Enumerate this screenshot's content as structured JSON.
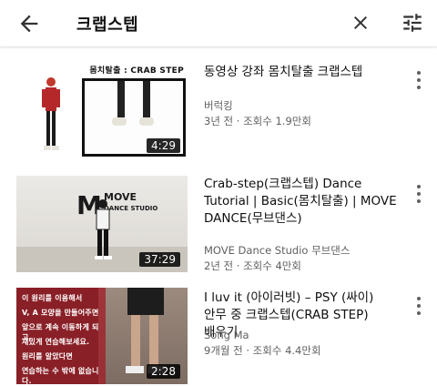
{
  "search": {
    "query": "크랩스텝"
  },
  "icons": {
    "back": "arrow-left-icon",
    "clear": "close-icon",
    "filter": "tune-filter-icon",
    "more": "more-vertical-icon"
  },
  "results": [
    {
      "title": "동영상 강좌 몸치탈출   크랩스텝",
      "channel": "버럭킹",
      "meta": "3년 전 · 조회수 1.9만회",
      "duration": "4:29",
      "thumb_caption": "몸치탈출 : CRAB STEP"
    },
    {
      "title": "Crab-step(크랩스텝) Dance Tutorial | Basic(몸치탈출) | MOVE DANCE(무브댄스)",
      "channel": "MOVE Dance Studio 무브댄스",
      "meta": "2년 전 · 조회수 4만회",
      "duration": "37:29",
      "thumb_logo": "MOVE",
      "thumb_logo_sub": "DANCE STUDIO"
    },
    {
      "title": "I luv it (아이러빗) – PSY (싸이) 안무 중 크랩스텝(CRAB STEP) 배우기",
      "channel": "Song Ma",
      "meta": "9개월 전 · 조회수 4.4만회",
      "duration": "2:28",
      "thumb_lines": [
        "이 원리를 이용해서",
        "V, A 모양을 만들어주면",
        "앞으로 계속 이동하게 되고,",
        "재밌게 연습해보세요.",
        "원리를 알았다면",
        "연습하는 수 밖에 없습니다."
      ]
    }
  ],
  "colors": {
    "text_primary": "#0f0f0f",
    "text_secondary": "#606060",
    "duration_bg": "#000000"
  }
}
